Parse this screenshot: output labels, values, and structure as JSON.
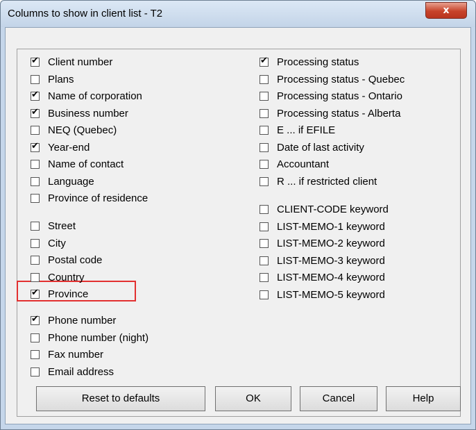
{
  "window": {
    "title": "Columns to show in client list - T2",
    "close_glyph": "x"
  },
  "left_group1": [
    {
      "label": "Client number",
      "checked": true
    },
    {
      "label": "Plans",
      "checked": false
    },
    {
      "label": "Name of corporation",
      "checked": true
    },
    {
      "label": "Business number",
      "checked": true
    },
    {
      "label": "NEQ (Quebec)",
      "checked": false
    },
    {
      "label": "Year-end",
      "checked": true
    },
    {
      "label": "Name of contact",
      "checked": false
    },
    {
      "label": "Language",
      "checked": false
    },
    {
      "label": "Province of residence",
      "checked": false
    }
  ],
  "left_group2": [
    {
      "label": "Street",
      "checked": false
    },
    {
      "label": "City",
      "checked": false
    },
    {
      "label": "Postal code",
      "checked": false
    },
    {
      "label": "Country",
      "checked": false
    },
    {
      "label": "Province",
      "checked": true
    }
  ],
  "left_group3": [
    {
      "label": "Phone number",
      "checked": true
    },
    {
      "label": "Phone number (night)",
      "checked": false
    },
    {
      "label": "Fax number",
      "checked": false
    },
    {
      "label": "Email address",
      "checked": false
    }
  ],
  "right_group1": [
    {
      "label": "Processing status",
      "checked": true
    },
    {
      "label": "Processing status - Quebec",
      "checked": false
    },
    {
      "label": "Processing status - Ontario",
      "checked": false
    },
    {
      "label": "Processing status - Alberta",
      "checked": false
    },
    {
      "label": "E ... if EFILE",
      "checked": false
    },
    {
      "label": "Date of last activity",
      "checked": false
    },
    {
      "label": "Accountant",
      "checked": false
    },
    {
      "label": "R ... if restricted client",
      "checked": false
    }
  ],
  "right_group2": [
    {
      "label": "CLIENT-CODE keyword",
      "checked": false
    },
    {
      "label": "LIST-MEMO-1 keyword",
      "checked": false
    },
    {
      "label": "LIST-MEMO-2 keyword",
      "checked": false
    },
    {
      "label": "LIST-MEMO-3 keyword",
      "checked": false
    },
    {
      "label": "LIST-MEMO-4 keyword",
      "checked": false
    },
    {
      "label": "LIST-MEMO-5 keyword",
      "checked": false
    }
  ],
  "buttons": {
    "reset": "Reset to defaults",
    "ok": "OK",
    "cancel": "Cancel",
    "help": "Help"
  },
  "colors": {
    "highlight": "#e23030",
    "close_button": "#c7432b"
  }
}
